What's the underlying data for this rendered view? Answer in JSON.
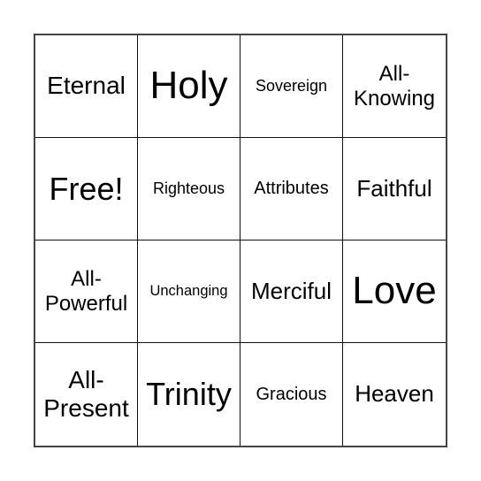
{
  "board": {
    "rows": [
      [
        "Eternal",
        "Holy",
        "Sovereign",
        "All-\nKnowing"
      ],
      [
        "Free!",
        "Righteous",
        "Attributes",
        "Faithful"
      ],
      [
        "All-\nPowerful",
        "Unchanging",
        "Merciful",
        "Love"
      ],
      [
        "All-\nPresent",
        "Trinity",
        "Gracious",
        "Heaven"
      ]
    ],
    "cells": {
      "r0c0": "Eternal",
      "r0c1": "Holy",
      "r0c2": "Sovereign",
      "r0c3_line1": "All-",
      "r0c3_line2": "Knowing",
      "r1c0": "Free!",
      "r1c1": "Righteous",
      "r1c2": "Attributes",
      "r1c3": "Faithful",
      "r2c0_line1": "All-",
      "r2c0_line2": "Powerful",
      "r2c1": "Unchanging",
      "r2c2": "Merciful",
      "r2c3": "Love",
      "r3c0_line1": "All-",
      "r3c0_line2": "Present",
      "r3c1": "Trinity",
      "r3c2": "Gracious",
      "r3c3": "Heaven"
    },
    "free_space": "Free!"
  },
  "colors": {
    "border": "#444444",
    "grid_line": "#111111",
    "text": "#000000",
    "background": "#ffffff"
  }
}
